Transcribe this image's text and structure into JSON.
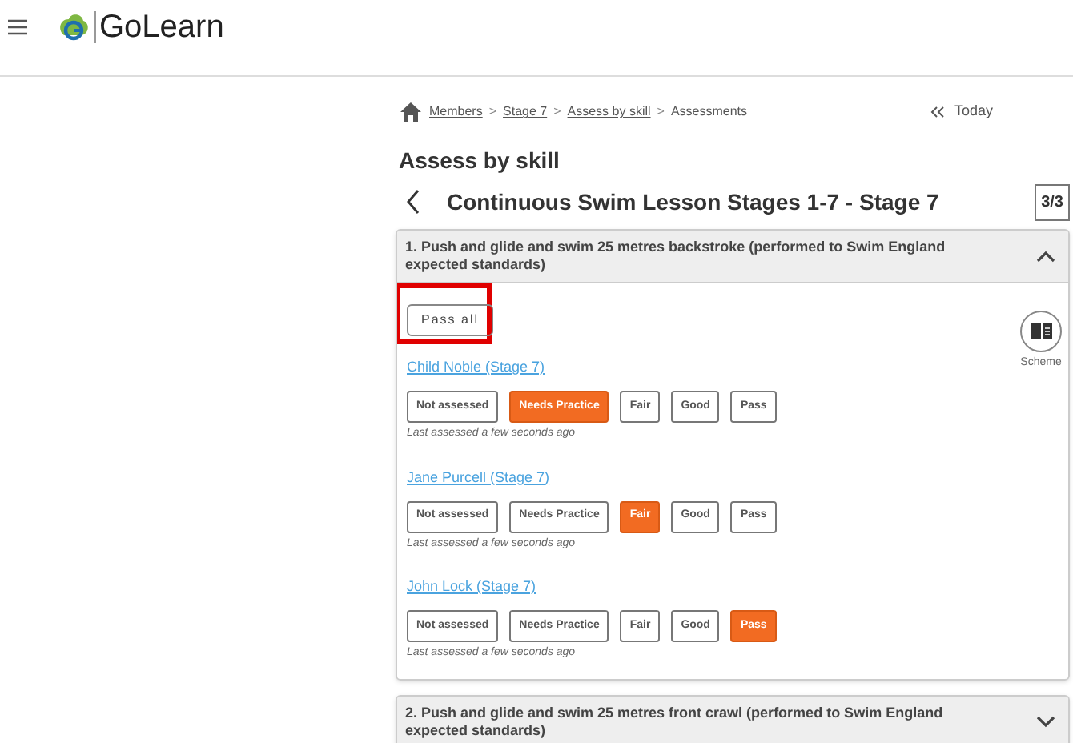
{
  "header": {
    "logo_text": "GoLearn"
  },
  "breadcrumb": [
    {
      "label": "Members",
      "link": true
    },
    {
      "label": "Stage 7",
      "link": true
    },
    {
      "label": "Assess by skill",
      "link": true
    },
    {
      "label": "Assessments",
      "link": false
    }
  ],
  "breadcrumb_separator": ">",
  "today_button": "Today",
  "page_title": "Assess by skill",
  "course_title": "Continuous Swim Lesson Stages 1-7 - Stage 7",
  "page_counter": "3/3",
  "skills": [
    {
      "title": "1. Push and glide and swim 25 metres backstroke (performed to Swim England expected standards)",
      "expanded": true,
      "pass_all": {
        "label": "Pass all",
        "highlighted": true
      },
      "scheme_label": "Scheme",
      "students": [
        {
          "name": "Child Noble (Stage 7)",
          "grades": [
            {
              "label": "Not assessed",
              "selected": false
            },
            {
              "label": "Needs Practice",
              "selected": true
            },
            {
              "label": "Fair",
              "selected": false
            },
            {
              "label": "Good",
              "selected": false
            },
            {
              "label": "Pass",
              "selected": false
            }
          ],
          "last_assessed": "Last assessed a few seconds ago"
        },
        {
          "name": "Jane Purcell (Stage 7)",
          "grades": [
            {
              "label": "Not assessed",
              "selected": false
            },
            {
              "label": "Needs Practice",
              "selected": false
            },
            {
              "label": "Fair",
              "selected": true
            },
            {
              "label": "Good",
              "selected": false
            },
            {
              "label": "Pass",
              "selected": false
            }
          ],
          "last_assessed": "Last assessed a few seconds ago"
        },
        {
          "name": "John Lock (Stage 7)",
          "grades": [
            {
              "label": "Not assessed",
              "selected": false
            },
            {
              "label": "Needs Practice",
              "selected": false
            },
            {
              "label": "Fair",
              "selected": false
            },
            {
              "label": "Good",
              "selected": false
            },
            {
              "label": "Pass",
              "selected": true
            }
          ],
          "last_assessed": "Last assessed a few seconds ago"
        }
      ]
    },
    {
      "title": "2. Push and glide and swim 25 metres front crawl (performed to Swim England expected standards)",
      "expanded": false
    }
  ]
}
